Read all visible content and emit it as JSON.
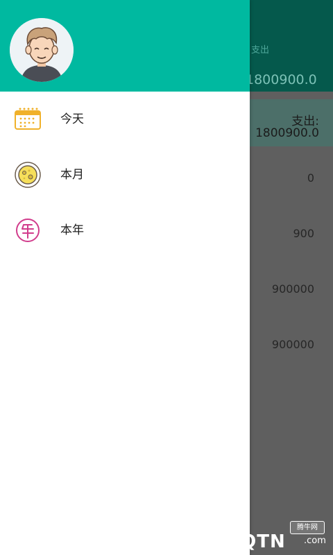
{
  "background": {
    "header_label": "支出",
    "header_value": "1800900.0",
    "summary_label": "支出:",
    "summary_value": "1800900.0",
    "rows": [
      "0",
      "900",
      "900000",
      "900000"
    ]
  },
  "drawer": {
    "header_color": "#00b9a0",
    "menu": [
      {
        "label": "今天",
        "icon": "calendar-icon"
      },
      {
        "label": "本月",
        "icon": "moon-icon"
      },
      {
        "label": "本年",
        "icon": "year-icon"
      }
    ]
  },
  "watermark": {
    "badge": "腾牛网",
    "text": "QQTN",
    "suffix": ".com"
  }
}
